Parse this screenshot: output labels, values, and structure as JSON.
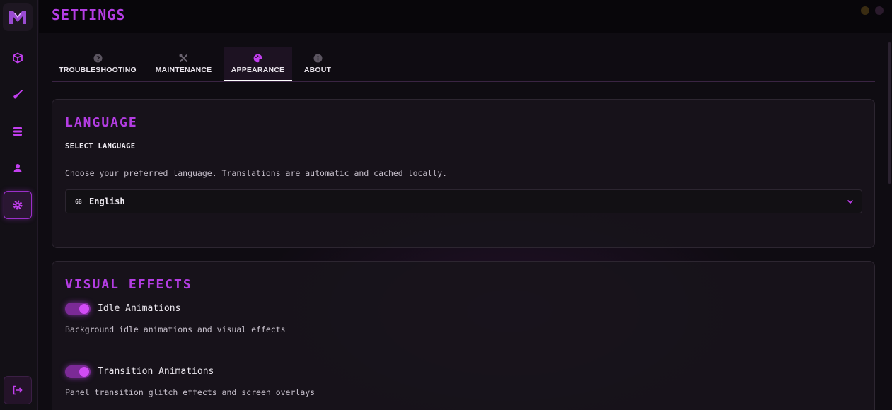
{
  "header": {
    "title": "SETTINGS"
  },
  "sidebar": {
    "logo_icon": "app-logo-m",
    "items": [
      {
        "name": "cube",
        "icon": "cube-icon"
      },
      {
        "name": "broom",
        "icon": "broom-icon"
      },
      {
        "name": "server",
        "icon": "server-icon"
      },
      {
        "name": "user",
        "icon": "user-icon"
      },
      {
        "name": "settings",
        "icon": "gear-icon",
        "active": true
      }
    ],
    "logout_icon": "logout-icon"
  },
  "tabs": [
    {
      "label": "TROUBLESHOOTING",
      "icon": "question-circle-icon"
    },
    {
      "label": "MAINTENANCE",
      "icon": "tools-icon"
    },
    {
      "label": "APPEARANCE",
      "icon": "palette-icon",
      "active": true
    },
    {
      "label": "ABOUT",
      "icon": "info-circle-icon"
    }
  ],
  "language": {
    "title": "LANGUAGE",
    "sublabel": "SELECT LANGUAGE",
    "description": "Choose your preferred language. Translations are automatic and cached locally.",
    "selected_flag": "GB",
    "selected_value": "English"
  },
  "visual_effects": {
    "title": "VISUAL EFFECTS",
    "toggles": [
      {
        "label": "Idle Animations",
        "description": "Background idle animations and visual effects",
        "on": true
      },
      {
        "label": "Transition Animations",
        "description": "Panel transition glitch effects and screen overlays",
        "on": true
      }
    ]
  },
  "colors": {
    "accent": "#b43de3",
    "toggle_on": "#d14cf5",
    "background": "#0f0c12"
  }
}
